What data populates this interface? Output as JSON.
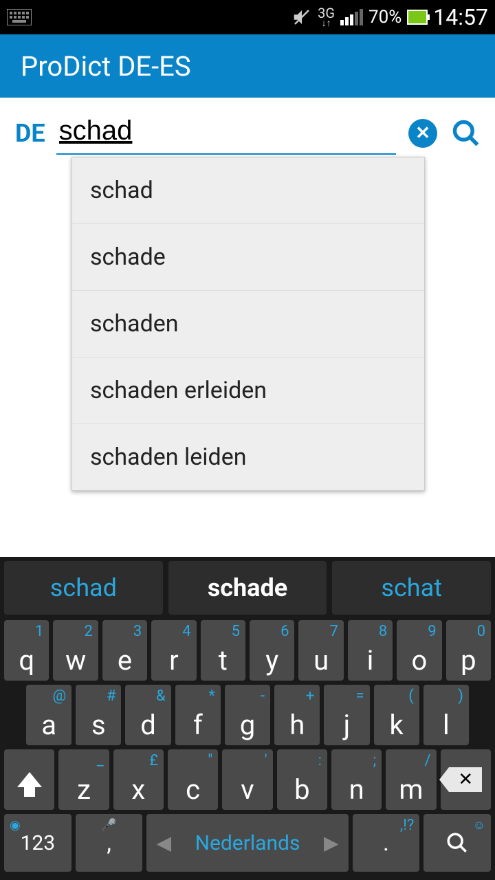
{
  "status": {
    "network": "3G",
    "battery_pct": "70%",
    "clock": "14:57"
  },
  "app": {
    "title": "ProDict DE-ES"
  },
  "search": {
    "lang": "DE",
    "value": "schad"
  },
  "suggestions": [
    "schad",
    "schade",
    "schaden",
    "schaden erleiden",
    "schaden leiden"
  ],
  "predictions": [
    "schad",
    "schade",
    "schat"
  ],
  "keyboard": {
    "row1": [
      {
        "k": "q",
        "a": "1"
      },
      {
        "k": "w",
        "a": "2"
      },
      {
        "k": "e",
        "a": "3"
      },
      {
        "k": "r",
        "a": "4"
      },
      {
        "k": "t",
        "a": "5"
      },
      {
        "k": "y",
        "a": "6"
      },
      {
        "k": "u",
        "a": "7"
      },
      {
        "k": "i",
        "a": "8"
      },
      {
        "k": "o",
        "a": "9"
      },
      {
        "k": "p",
        "a": "0"
      }
    ],
    "row2": [
      {
        "k": "a",
        "a": "@"
      },
      {
        "k": "s",
        "a": "#"
      },
      {
        "k": "d",
        "a": "&"
      },
      {
        "k": "f",
        "a": "*"
      },
      {
        "k": "g",
        "a": "-"
      },
      {
        "k": "h",
        "a": "+"
      },
      {
        "k": "j",
        "a": "="
      },
      {
        "k": "k",
        "a": "("
      },
      {
        "k": "l",
        "a": ")"
      }
    ],
    "row3": [
      {
        "k": "z",
        "a": "_"
      },
      {
        "k": "x",
        "a": "£"
      },
      {
        "k": "c",
        "a": "\""
      },
      {
        "k": "v",
        "a": "'"
      },
      {
        "k": "b",
        "a": ":"
      },
      {
        "k": "n",
        "a": ";"
      },
      {
        "k": "m",
        "a": "/"
      }
    ],
    "sym_key": "123",
    "comma_key": ",",
    "space_label": "Nederlands",
    "dot_key": ".",
    "dot_alt": ",!?"
  }
}
